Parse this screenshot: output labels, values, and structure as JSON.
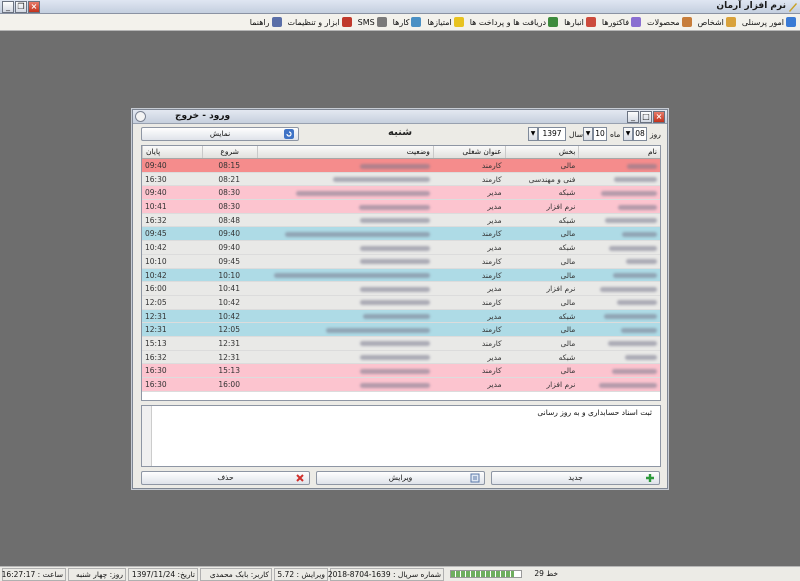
{
  "app": {
    "title": "نرم افزار آرمان"
  },
  "menu": [
    {
      "label": "امور پرسنلی",
      "icon": "personnel-icon",
      "color": "#3a7bd5"
    },
    {
      "label": "اشخاص",
      "icon": "people-icon",
      "color": "#d9a23b"
    },
    {
      "label": "محصولات",
      "icon": "product-icon",
      "color": "#c77d3a"
    },
    {
      "label": "فاکتورها",
      "icon": "invoice-icon",
      "color": "#8a6fd1"
    },
    {
      "label": "انبارها",
      "icon": "warehouse-icon",
      "color": "#cc4b3c"
    },
    {
      "label": "دریافت ها و پرداخت ها",
      "icon": "payment-icon",
      "color": "#3d8b3d"
    },
    {
      "label": "امتیازها",
      "icon": "star-icon",
      "color": "#e8c31f"
    },
    {
      "label": "کارها",
      "icon": "tasks-icon",
      "color": "#4a90c4"
    },
    {
      "label": "SMS",
      "icon": "sms-icon",
      "color": "#7a7a7a"
    },
    {
      "label": "ابزار و تنظیمات",
      "icon": "tools-icon",
      "color": "#c0392b"
    },
    {
      "label": "راهنما",
      "icon": "help-icon",
      "color": "#5a6fa8"
    }
  ],
  "dialog": {
    "title": "ورود - خروج",
    "day_label": "روز",
    "day": "08",
    "month_label": "ماه",
    "month": "10",
    "year_label": "سال",
    "year": "1397",
    "weekday": "شنبه",
    "show_button": "نمایش",
    "columns": {
      "name": "نام",
      "dept": "بخش",
      "job": "عنوان شغلی",
      "status": "وضعیت",
      "start": "شروع",
      "end": "پایان"
    },
    "rows": [
      {
        "dept": "مالی",
        "job": "کارمند",
        "start": "08:15",
        "end": "09:40",
        "color": "#f58c8c",
        "status_blur": false
      },
      {
        "dept": "فنی و مهندسی",
        "job": "کارمند",
        "start": "08:21",
        "end": "16:30",
        "color": "#e9e9e7",
        "status_blur": true
      },
      {
        "dept": "شبکه",
        "job": "مدیر",
        "start": "08:30",
        "end": "09:40",
        "color": "#fcc4cf",
        "status_blur": true
      },
      {
        "dept": "نرم افزار",
        "job": "مدیر",
        "start": "08:30",
        "end": "10:41",
        "color": "#fcc4cf",
        "status_blur": true
      },
      {
        "dept": "شبکه",
        "job": "مدیر",
        "start": "08:48",
        "end": "16:32",
        "color": "#e9e9e7",
        "status_blur": false
      },
      {
        "dept": "مالی",
        "job": "کارمند",
        "start": "09:40",
        "end": "09:45",
        "color": "#aedbe6",
        "status_blur": true
      },
      {
        "dept": "شبکه",
        "job": "مدیر",
        "start": "09:40",
        "end": "10:42",
        "color": "#e9e9e7",
        "status_blur": false
      },
      {
        "dept": "مالی",
        "job": "کارمند",
        "start": "09:45",
        "end": "10:10",
        "color": "#e9e9e7",
        "status_blur": false
      },
      {
        "dept": "مالی",
        "job": "کارمند",
        "start": "10:10",
        "end": "10:42",
        "color": "#aedbe6",
        "status_blur": true
      },
      {
        "dept": "نرم افزار",
        "job": "مدیر",
        "start": "10:41",
        "end": "16:00",
        "color": "#e9e9e7",
        "status_blur": false
      },
      {
        "dept": "مالی",
        "job": "کارمند",
        "start": "10:42",
        "end": "12:05",
        "color": "#e9e9e7",
        "status_blur": false
      },
      {
        "dept": "شبکه",
        "job": "مدیر",
        "start": "10:42",
        "end": "12:31",
        "color": "#aedbe6",
        "status_blur": true
      },
      {
        "dept": "مالی",
        "job": "کارمند",
        "start": "12:05",
        "end": "12:31",
        "color": "#aedbe6",
        "status_blur": true
      },
      {
        "dept": "مالی",
        "job": "کارمند",
        "start": "12:31",
        "end": "15:13",
        "color": "#e9e9e7",
        "status_blur": false
      },
      {
        "dept": "شبکه",
        "job": "مدیر",
        "start": "12:31",
        "end": "16:32",
        "color": "#e9e9e7",
        "status_blur": false
      },
      {
        "dept": "مالی",
        "job": "کارمند",
        "start": "15:13",
        "end": "16:30",
        "color": "#fcc4cf",
        "status_blur": false
      },
      {
        "dept": "نرم افزار",
        "job": "مدیر",
        "start": "16:00",
        "end": "16:30",
        "color": "#fcc4cf",
        "status_blur": false
      }
    ],
    "note": "ثبت اسناد حسابداری و به روز رسانی",
    "buttons": {
      "new": "جدید",
      "edit": "ویرایش",
      "delete": "حذف"
    }
  },
  "status": {
    "line": "خط 29",
    "serial": "شماره سریال : 1639-8704-2018",
    "version": "ویرایش : 5.72",
    "user": "کاربر: بابک محمدی",
    "date": "تاریخ: 1397/11/24",
    "day": "روز: چهار شنبه",
    "time": "ساعت : 16:27:17",
    "progress": 0.9
  }
}
